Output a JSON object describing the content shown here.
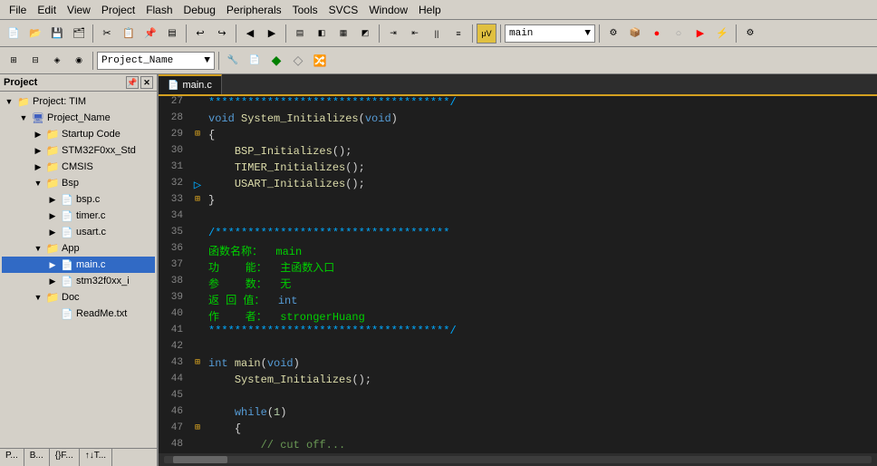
{
  "menubar": {
    "items": [
      "File",
      "Edit",
      "View",
      "Project",
      "Flash",
      "Debug",
      "Peripherals",
      "Tools",
      "SVCS",
      "Window",
      "Help"
    ]
  },
  "toolbar": {
    "dropdown_value": "main",
    "dropdown2_value": "Project_Name"
  },
  "project_panel": {
    "title": "Project",
    "tree": [
      {
        "id": "project-tim",
        "label": "Project: TIM",
        "level": 0,
        "expanded": true,
        "type": "project"
      },
      {
        "id": "project-name",
        "label": "Project_Name",
        "level": 1,
        "expanded": true,
        "type": "project"
      },
      {
        "id": "startup-code",
        "label": "Startup Code",
        "level": 2,
        "expanded": false,
        "type": "folder"
      },
      {
        "id": "stm32f0xx-std",
        "label": "STM32F0xx_Std",
        "level": 2,
        "expanded": false,
        "type": "folder"
      },
      {
        "id": "cmsis",
        "label": "CMSIS",
        "level": 2,
        "expanded": false,
        "type": "folder"
      },
      {
        "id": "bsp",
        "label": "Bsp",
        "level": 2,
        "expanded": true,
        "type": "folder"
      },
      {
        "id": "bsp-c",
        "label": "bsp.c",
        "level": 3,
        "expanded": false,
        "type": "file"
      },
      {
        "id": "timer-c",
        "label": "timer.c",
        "level": 3,
        "expanded": false,
        "type": "file"
      },
      {
        "id": "usart-c",
        "label": "usart.c",
        "level": 3,
        "expanded": false,
        "type": "file"
      },
      {
        "id": "app",
        "label": "App",
        "level": 2,
        "expanded": true,
        "type": "folder"
      },
      {
        "id": "main-c",
        "label": "main.c",
        "level": 3,
        "expanded": false,
        "type": "file"
      },
      {
        "id": "stm32f0xx-i",
        "label": "stm32f0xx_i",
        "level": 3,
        "expanded": false,
        "type": "file"
      },
      {
        "id": "doc",
        "label": "Doc",
        "level": 2,
        "expanded": true,
        "type": "folder"
      },
      {
        "id": "readme",
        "label": "ReadMe.txt",
        "level": 3,
        "expanded": false,
        "type": "file"
      }
    ]
  },
  "editor": {
    "active_tab": "main.c",
    "tabs": [
      "main.c"
    ],
    "lines": [
      {
        "num": 27,
        "indicator": "",
        "content": "*************************************/",
        "type": "stars"
      },
      {
        "num": 28,
        "indicator": "",
        "content": "void System_Initializes(void)",
        "type": "code"
      },
      {
        "num": 29,
        "indicator": "{",
        "content": "{",
        "type": "brace"
      },
      {
        "num": 30,
        "indicator": "",
        "content": "    BSP_Initializes();",
        "type": "code"
      },
      {
        "num": 31,
        "indicator": "",
        "content": "    TIMER_Initializes();",
        "type": "code"
      },
      {
        "num": 32,
        "indicator": "",
        "content": "    USART_Initializes();",
        "type": "code"
      },
      {
        "num": 33,
        "indicator": "}",
        "content": "}",
        "type": "brace"
      },
      {
        "num": 34,
        "indicator": "",
        "content": "",
        "type": "empty"
      },
      {
        "num": 35,
        "indicator": "",
        "content": "/************************************",
        "type": "stars"
      },
      {
        "num": 36,
        "indicator": "",
        "content": "函数名称：  main",
        "type": "comment_cn"
      },
      {
        "num": 37,
        "indicator": "",
        "content": "功    能：  主函数入口",
        "type": "comment_cn"
      },
      {
        "num": 38,
        "indicator": "",
        "content": "参    数：  无",
        "type": "comment_cn"
      },
      {
        "num": 39,
        "indicator": "",
        "content": "返 回 值：  int",
        "type": "comment_cn"
      },
      {
        "num": 40,
        "indicator": "",
        "content": "作    者：  strongerHuang",
        "type": "comment_cn"
      },
      {
        "num": 41,
        "indicator": "",
        "content": "*************************************/",
        "type": "stars"
      },
      {
        "num": 42,
        "indicator": "",
        "content": "",
        "type": "empty"
      },
      {
        "num": 43,
        "indicator": "{",
        "content": "int main(void)",
        "type": "code"
      },
      {
        "num": 44,
        "indicator": "",
        "content": "    System_Initializes();",
        "type": "code"
      },
      {
        "num": 45,
        "indicator": "",
        "content": "",
        "type": "empty"
      },
      {
        "num": 46,
        "indicator": "",
        "content": "    while(1)",
        "type": "code"
      },
      {
        "num": 47,
        "indicator": "{",
        "content": "    {",
        "type": "brace"
      },
      {
        "num": 48,
        "indicator": "",
        "content": "        ...",
        "type": "code"
      }
    ]
  },
  "bottom_tabs": [
    "P...",
    "B...",
    "{}F...",
    "↑↓T..."
  ],
  "status": ""
}
